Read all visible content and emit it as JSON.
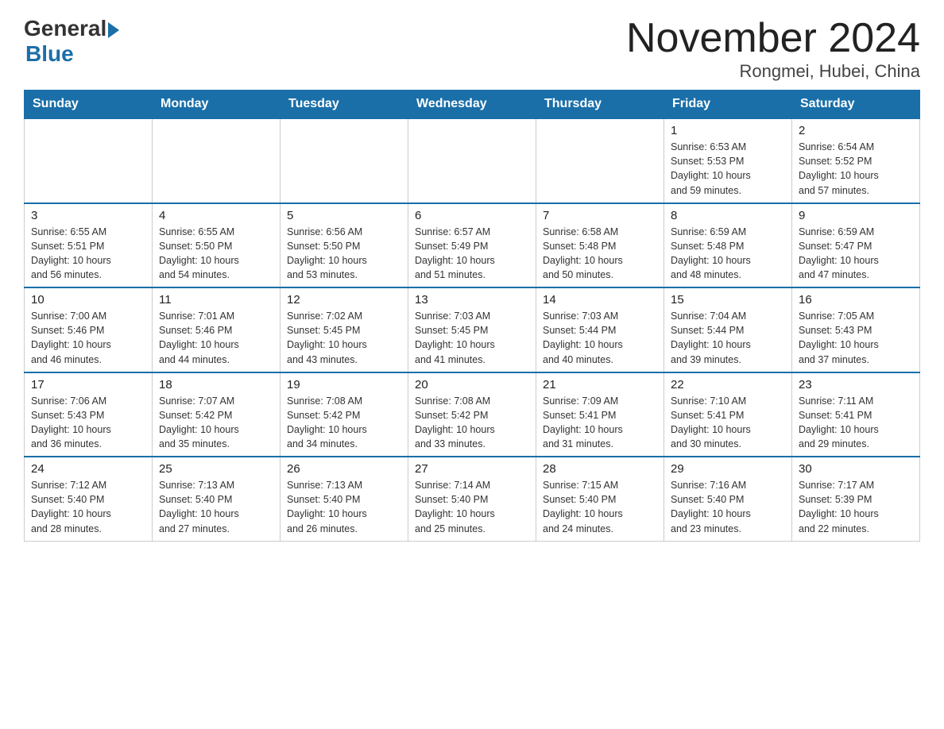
{
  "header": {
    "logo_general": "General",
    "logo_blue": "Blue",
    "title": "November 2024",
    "location": "Rongmei, Hubei, China"
  },
  "days_of_week": [
    "Sunday",
    "Monday",
    "Tuesday",
    "Wednesday",
    "Thursday",
    "Friday",
    "Saturday"
  ],
  "weeks": [
    [
      {
        "day": "",
        "info": ""
      },
      {
        "day": "",
        "info": ""
      },
      {
        "day": "",
        "info": ""
      },
      {
        "day": "",
        "info": ""
      },
      {
        "day": "",
        "info": ""
      },
      {
        "day": "1",
        "info": "Sunrise: 6:53 AM\nSunset: 5:53 PM\nDaylight: 10 hours\nand 59 minutes."
      },
      {
        "day": "2",
        "info": "Sunrise: 6:54 AM\nSunset: 5:52 PM\nDaylight: 10 hours\nand 57 minutes."
      }
    ],
    [
      {
        "day": "3",
        "info": "Sunrise: 6:55 AM\nSunset: 5:51 PM\nDaylight: 10 hours\nand 56 minutes."
      },
      {
        "day": "4",
        "info": "Sunrise: 6:55 AM\nSunset: 5:50 PM\nDaylight: 10 hours\nand 54 minutes."
      },
      {
        "day": "5",
        "info": "Sunrise: 6:56 AM\nSunset: 5:50 PM\nDaylight: 10 hours\nand 53 minutes."
      },
      {
        "day": "6",
        "info": "Sunrise: 6:57 AM\nSunset: 5:49 PM\nDaylight: 10 hours\nand 51 minutes."
      },
      {
        "day": "7",
        "info": "Sunrise: 6:58 AM\nSunset: 5:48 PM\nDaylight: 10 hours\nand 50 minutes."
      },
      {
        "day": "8",
        "info": "Sunrise: 6:59 AM\nSunset: 5:48 PM\nDaylight: 10 hours\nand 48 minutes."
      },
      {
        "day": "9",
        "info": "Sunrise: 6:59 AM\nSunset: 5:47 PM\nDaylight: 10 hours\nand 47 minutes."
      }
    ],
    [
      {
        "day": "10",
        "info": "Sunrise: 7:00 AM\nSunset: 5:46 PM\nDaylight: 10 hours\nand 46 minutes."
      },
      {
        "day": "11",
        "info": "Sunrise: 7:01 AM\nSunset: 5:46 PM\nDaylight: 10 hours\nand 44 minutes."
      },
      {
        "day": "12",
        "info": "Sunrise: 7:02 AM\nSunset: 5:45 PM\nDaylight: 10 hours\nand 43 minutes."
      },
      {
        "day": "13",
        "info": "Sunrise: 7:03 AM\nSunset: 5:45 PM\nDaylight: 10 hours\nand 41 minutes."
      },
      {
        "day": "14",
        "info": "Sunrise: 7:03 AM\nSunset: 5:44 PM\nDaylight: 10 hours\nand 40 minutes."
      },
      {
        "day": "15",
        "info": "Sunrise: 7:04 AM\nSunset: 5:44 PM\nDaylight: 10 hours\nand 39 minutes."
      },
      {
        "day": "16",
        "info": "Sunrise: 7:05 AM\nSunset: 5:43 PM\nDaylight: 10 hours\nand 37 minutes."
      }
    ],
    [
      {
        "day": "17",
        "info": "Sunrise: 7:06 AM\nSunset: 5:43 PM\nDaylight: 10 hours\nand 36 minutes."
      },
      {
        "day": "18",
        "info": "Sunrise: 7:07 AM\nSunset: 5:42 PM\nDaylight: 10 hours\nand 35 minutes."
      },
      {
        "day": "19",
        "info": "Sunrise: 7:08 AM\nSunset: 5:42 PM\nDaylight: 10 hours\nand 34 minutes."
      },
      {
        "day": "20",
        "info": "Sunrise: 7:08 AM\nSunset: 5:42 PM\nDaylight: 10 hours\nand 33 minutes."
      },
      {
        "day": "21",
        "info": "Sunrise: 7:09 AM\nSunset: 5:41 PM\nDaylight: 10 hours\nand 31 minutes."
      },
      {
        "day": "22",
        "info": "Sunrise: 7:10 AM\nSunset: 5:41 PM\nDaylight: 10 hours\nand 30 minutes."
      },
      {
        "day": "23",
        "info": "Sunrise: 7:11 AM\nSunset: 5:41 PM\nDaylight: 10 hours\nand 29 minutes."
      }
    ],
    [
      {
        "day": "24",
        "info": "Sunrise: 7:12 AM\nSunset: 5:40 PM\nDaylight: 10 hours\nand 28 minutes."
      },
      {
        "day": "25",
        "info": "Sunrise: 7:13 AM\nSunset: 5:40 PM\nDaylight: 10 hours\nand 27 minutes."
      },
      {
        "day": "26",
        "info": "Sunrise: 7:13 AM\nSunset: 5:40 PM\nDaylight: 10 hours\nand 26 minutes."
      },
      {
        "day": "27",
        "info": "Sunrise: 7:14 AM\nSunset: 5:40 PM\nDaylight: 10 hours\nand 25 minutes."
      },
      {
        "day": "28",
        "info": "Sunrise: 7:15 AM\nSunset: 5:40 PM\nDaylight: 10 hours\nand 24 minutes."
      },
      {
        "day": "29",
        "info": "Sunrise: 7:16 AM\nSunset: 5:40 PM\nDaylight: 10 hours\nand 23 minutes."
      },
      {
        "day": "30",
        "info": "Sunrise: 7:17 AM\nSunset: 5:39 PM\nDaylight: 10 hours\nand 22 minutes."
      }
    ]
  ]
}
